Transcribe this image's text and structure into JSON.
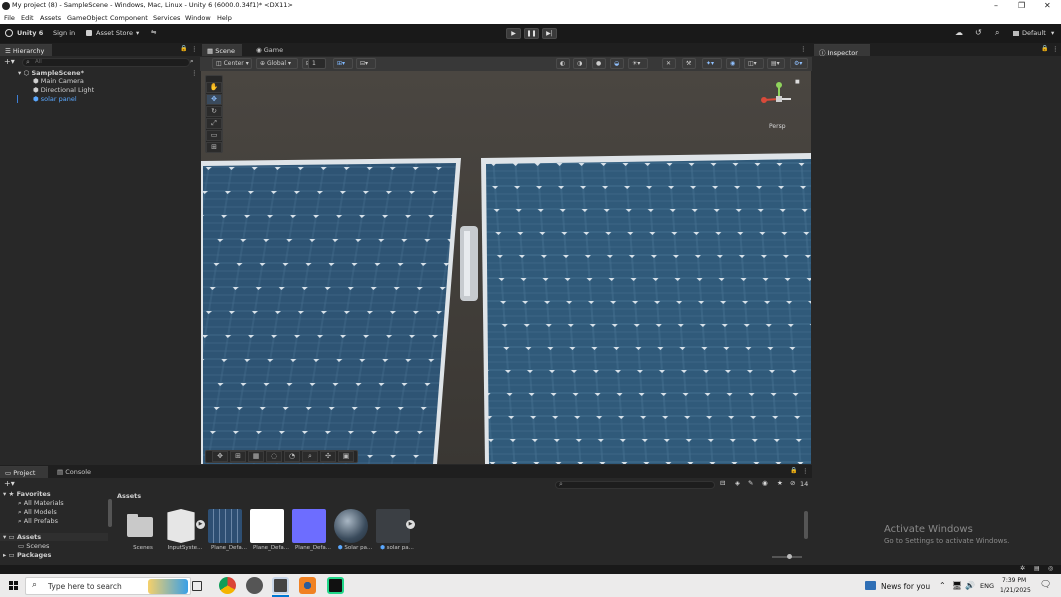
{
  "window": {
    "title": "My project (8) - SampleScene - Windows, Mac, Linux - Unity 6 (6000.0.34f1)* <DX11>",
    "minimize": "–",
    "restore": "❐",
    "close": "✕"
  },
  "menu": [
    "File",
    "Edit",
    "Assets",
    "GameObject",
    "Component",
    "Services",
    "Window",
    "Help"
  ],
  "toolbar": {
    "unity_label": "Unity 6",
    "signin": "Sign in",
    "asset_store": "Asset Store",
    "layout": "Default"
  },
  "hierarchy": {
    "tab": "Hierarchy",
    "search_placeholder": "All",
    "scene": "SampleScene*",
    "items": [
      "Main Camera",
      "Directional Light",
      "solar panel"
    ]
  },
  "scene": {
    "tab_scene": "Scene",
    "tab_game": "Game",
    "pivot": "Center",
    "space": "Global",
    "snap_value": "1",
    "persp": "Persp"
  },
  "inspector": {
    "tab": "Inspector"
  },
  "project": {
    "tab_project": "Project",
    "tab_console": "Console",
    "favorites_label": "Favorites",
    "favorites": [
      "All Materials",
      "All Models",
      "All Prefabs"
    ],
    "assets_label": "Assets",
    "scenes_label": "Scenes",
    "packages_label": "Packages",
    "breadcrumb": "Assets",
    "count": "14",
    "items": [
      {
        "label": "Scenes",
        "color": "#c9c9c9"
      },
      {
        "label": "InputSyste...",
        "color": "#e6e6e6"
      },
      {
        "label": "Plane_Defa...",
        "color": "#3f5f86"
      },
      {
        "label": "Plane_Defa...",
        "color": "#ffffff"
      },
      {
        "label": "Plane_Defa...",
        "color": "#6d6dff"
      },
      {
        "label": "Solar pa...",
        "color": "#4a5a6a"
      },
      {
        "label": "solar pa...",
        "color": "#55606a"
      }
    ]
  },
  "watermark": {
    "line1": "Activate Windows",
    "line2": "Go to Settings to activate Windows."
  },
  "taskbar": {
    "search_placeholder": "Type here to search",
    "news": "News for you",
    "lang": "ENG",
    "time": "7:39 PM",
    "date": "1/21/2025"
  }
}
